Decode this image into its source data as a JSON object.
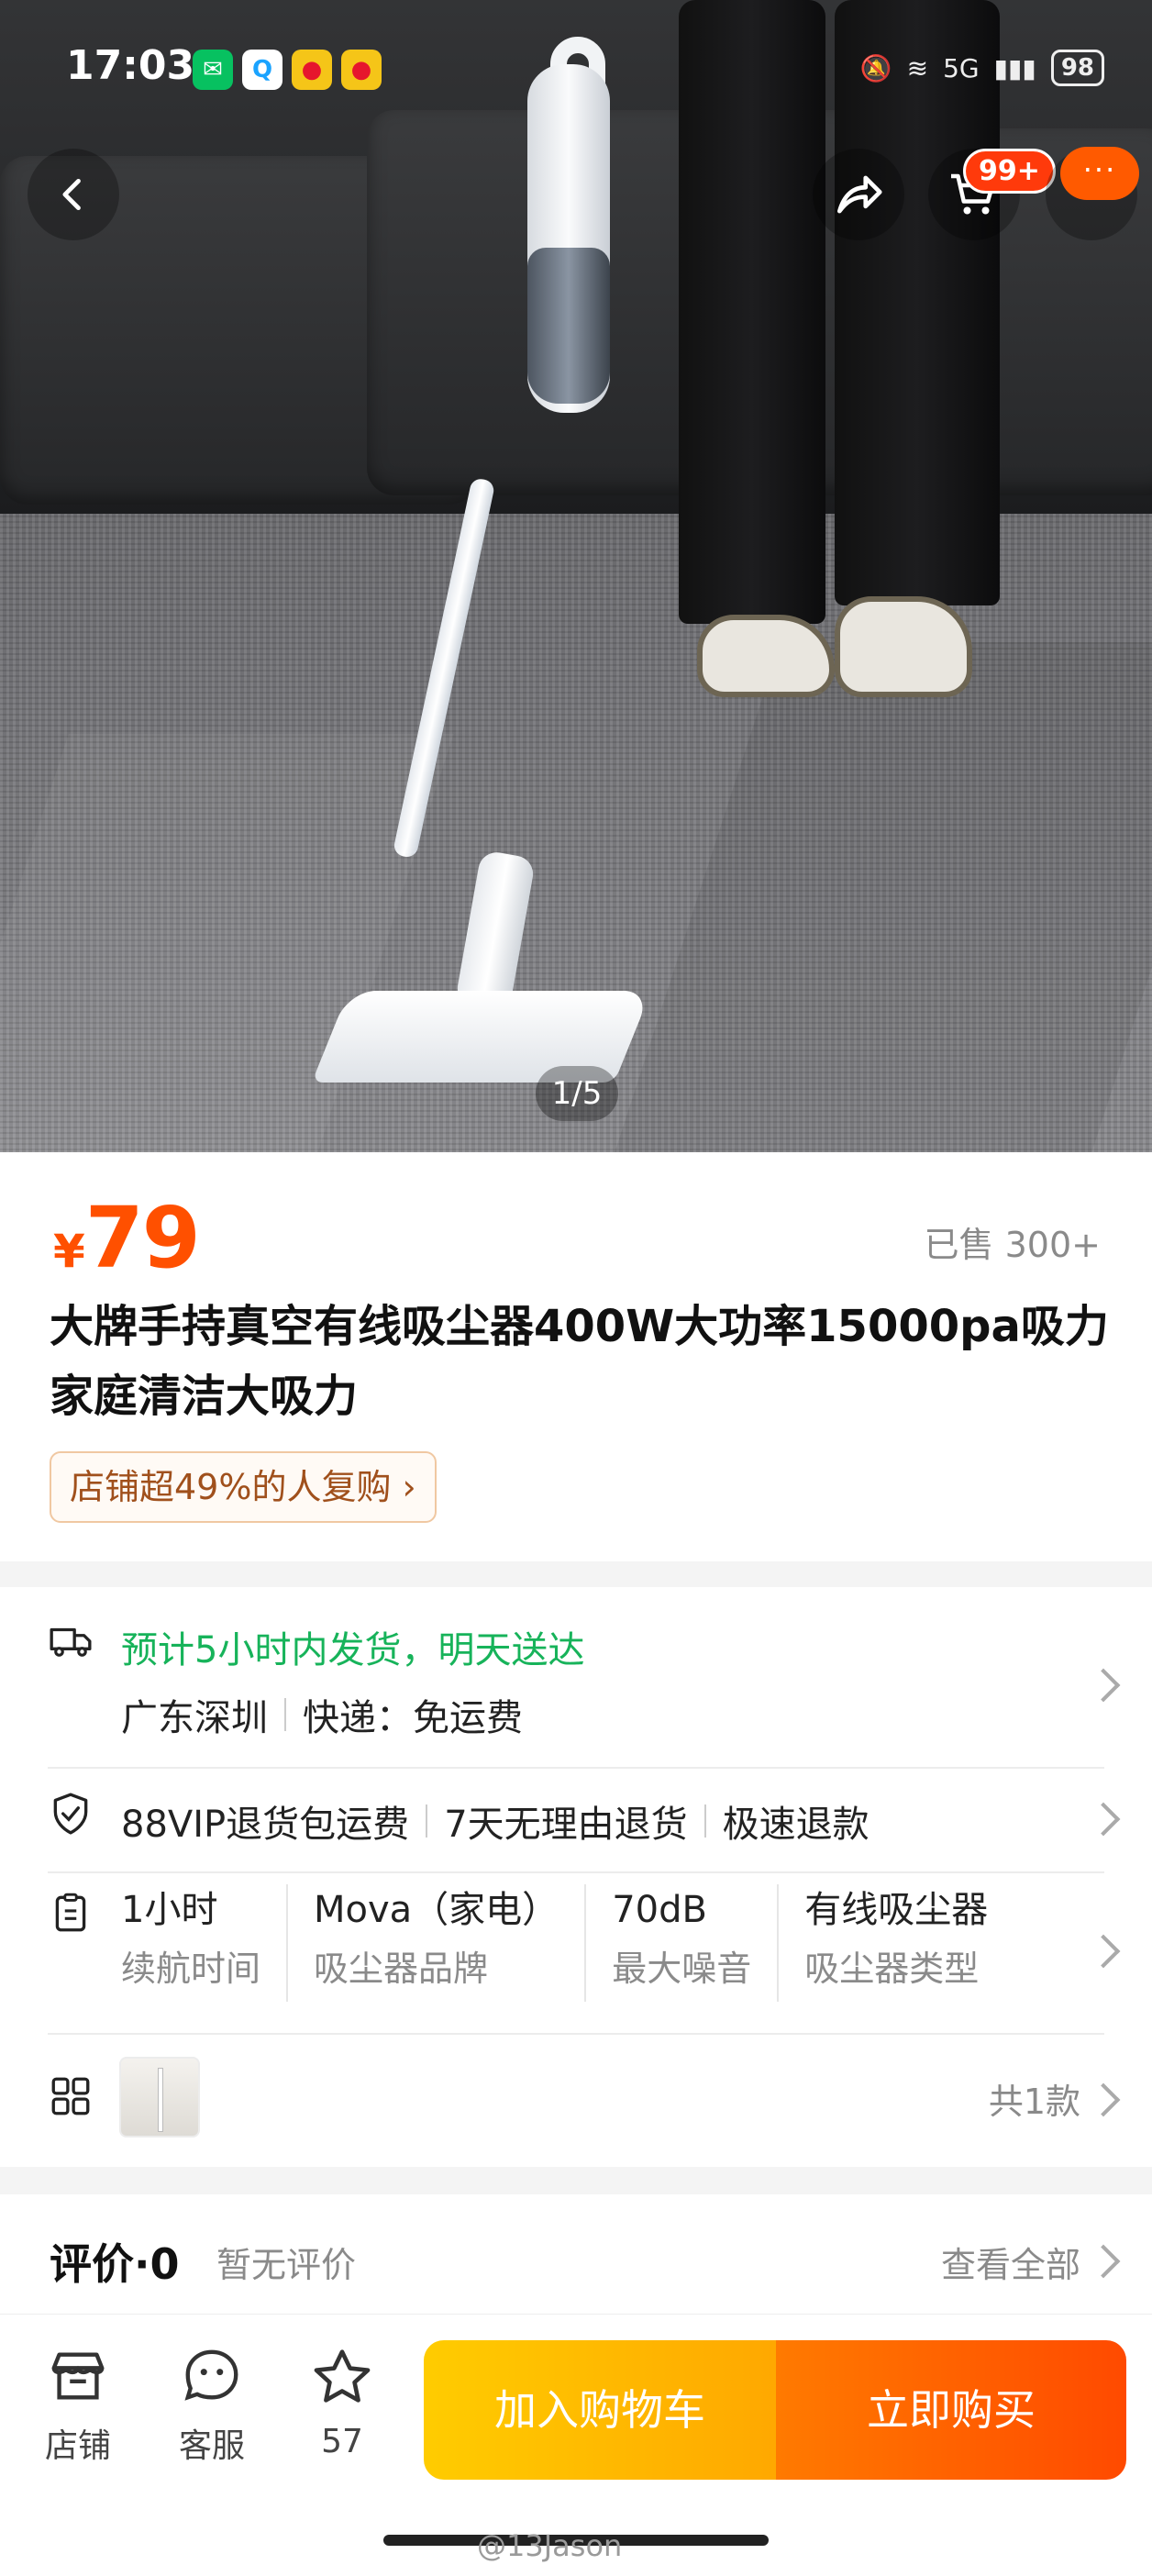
{
  "status_bar": {
    "time": "17:03",
    "battery": "98",
    "network": "5G",
    "apps": [
      "wechat-icon",
      "qq-icon",
      "weibo-icon",
      "weibo-icon"
    ]
  },
  "gallery": {
    "pager": "1/5"
  },
  "nav": {
    "cart_badge": "99+",
    "more_label": "···"
  },
  "product": {
    "price_symbol": "¥",
    "price": "79",
    "sold": "已售 300+",
    "title": "大牌手持真空有线吸尘器400W大功率15000pa吸力家庭清洁大吸力",
    "repurchase": "店铺超49%的人复购 ›"
  },
  "shipping": {
    "eta": "预计5小时内发货，明天送达",
    "origin": "广东深圳",
    "fee": "快递：免运费"
  },
  "services": [
    "88VIP退货包运费",
    "7天无理由退货",
    "极速退款"
  ],
  "params": [
    {
      "value": "1小时",
      "key": "续航时间"
    },
    {
      "value": "Mova（家电）",
      "key": "吸尘器品牌"
    },
    {
      "value": "70dB",
      "key": "最大噪音"
    },
    {
      "value": "有线吸尘器",
      "key": "吸尘器类型"
    }
  ],
  "variants": {
    "count": "共1款"
  },
  "reviews": {
    "title": "评价·0",
    "none": "暂无评价",
    "view_all": "查看全部"
  },
  "bottom_bar": {
    "store": "店铺",
    "service": "客服",
    "favorites": "57",
    "add_to_cart": "加入购物车",
    "buy_now": "立即购买"
  },
  "watermark": "@13Jason",
  "colors": {
    "price": "#ff5000",
    "ship_green": "#17b35a",
    "cart_btn": "#ffb800",
    "buy_btn": "#ff5a00"
  }
}
